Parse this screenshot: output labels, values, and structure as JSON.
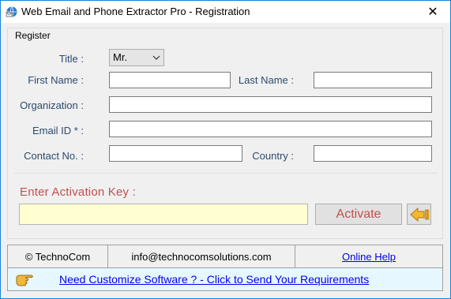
{
  "window": {
    "title": "Web Email and Phone Extractor Pro - Registration",
    "close_glyph": "✕"
  },
  "register": {
    "legend": "Register",
    "title_label": "Title :",
    "title_value": "Mr.",
    "first_name_label": "First Name :",
    "first_name_value": "",
    "last_name_label": "Last Name :",
    "last_name_value": "",
    "organization_label": "Organization :",
    "organization_value": "",
    "email_label": "Email ID * :",
    "email_value": "",
    "contact_label": "Contact No. :",
    "contact_value": "",
    "country_label": "Country :",
    "country_value": ""
  },
  "activation": {
    "label": "Enter Activation Key  :",
    "key_value": "",
    "activate_label": "Activate",
    "back_icon": "back-arrow-icon"
  },
  "footer": {
    "company": "© TechnoCom",
    "email": "info@technocomsolutions.com",
    "help_link": "Online Help"
  },
  "banner": {
    "icon": "pointing-hand-icon",
    "link_text": "Need Customize Software ? - Click to Send Your Requirements"
  },
  "colors": {
    "accent_label": "#2c4a6e",
    "activation_red": "#c0504d",
    "key_field_bg": "#ffffd2",
    "banner_bg": "#e6f7ff",
    "link_blue": "#0000ee"
  }
}
